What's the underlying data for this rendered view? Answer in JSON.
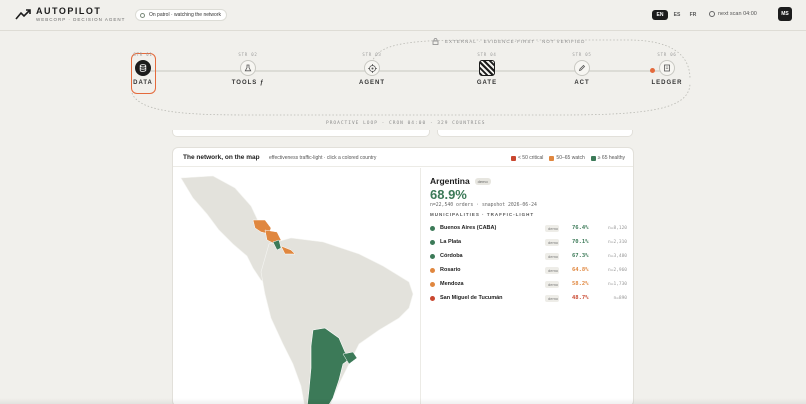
{
  "brand": {
    "title": "AUTOPILOT",
    "subtitle": "WEBCORP · DECISION AGENT"
  },
  "status": {
    "text": "On patrol · watching the network"
  },
  "languages": [
    "EN",
    "ES",
    "FR"
  ],
  "active_language": "EN",
  "next_scan": "next scan 04:00",
  "user": {
    "initials": "MS"
  },
  "pipeline": {
    "external_label": "EXTERNAL · EVIDENCE-FIRST · NOT VERIFIED",
    "loop_label": "PROACTIVE LOOP · CRON 04:00 · 329 COUNTRIES",
    "steps": [
      {
        "code": "STR 01",
        "label": "DATA",
        "icon": "database-icon",
        "active": true
      },
      {
        "code": "STR 02",
        "label": "TOOLS ƒ",
        "icon": "flask-icon",
        "active": false
      },
      {
        "code": "STR 03",
        "label": "AGENT",
        "icon": "target-icon",
        "active": false
      },
      {
        "code": "STR 04",
        "label": "GATE",
        "icon": "striped-gate-icon",
        "active": false
      },
      {
        "code": "STR 05",
        "label": "ACT",
        "icon": "pen-icon",
        "active": false
      },
      {
        "code": "STR 06",
        "label": "LEDGER",
        "icon": "scroll-icon",
        "active": false
      }
    ]
  },
  "card": {
    "title": "The network, on the map",
    "subtitle": "effectiveness traffic-light · click a colored country",
    "legend": [
      {
        "label": "< 50 critical",
        "color": "#c9472f"
      },
      {
        "label": "50–65 watch",
        "color": "#e0873f"
      },
      {
        "label": "≥ 65 healthy",
        "color": "#3c7a58"
      }
    ]
  },
  "detail": {
    "country": "Argentina",
    "tag": "demo",
    "effectiveness": "68.9%",
    "meta": "n=22,540 orders · snapshot 2026-06-24",
    "section_label": "MUNICIPALITIES · TRAFFIC-LIGHT",
    "municipalities": [
      {
        "name": "Buenos Aires (CABA)",
        "tag": "demo",
        "pct": "76.4%",
        "n": "n=8,120",
        "color": "#3c7a58"
      },
      {
        "name": "La Plata",
        "tag": "demo",
        "pct": "70.1%",
        "n": "n=2,310",
        "color": "#3c7a58"
      },
      {
        "name": "Córdoba",
        "tag": "demo",
        "pct": "67.3%",
        "n": "n=3,480",
        "color": "#3c7a58"
      },
      {
        "name": "Rosario",
        "tag": "demo",
        "pct": "64.8%",
        "n": "n=2,960",
        "color": "#e0873f"
      },
      {
        "name": "Mendoza",
        "tag": "demo",
        "pct": "58.2%",
        "n": "n=1,730",
        "color": "#e0873f"
      },
      {
        "name": "San Miguel de Tucumán",
        "tag": "demo",
        "pct": "48.7%",
        "n": "n=890",
        "color": "#c9472f"
      }
    ]
  },
  "colors": {
    "accent": "#e46a3c",
    "healthy": "#3c7a58",
    "watch": "#e0873f",
    "critical": "#c9472f"
  }
}
